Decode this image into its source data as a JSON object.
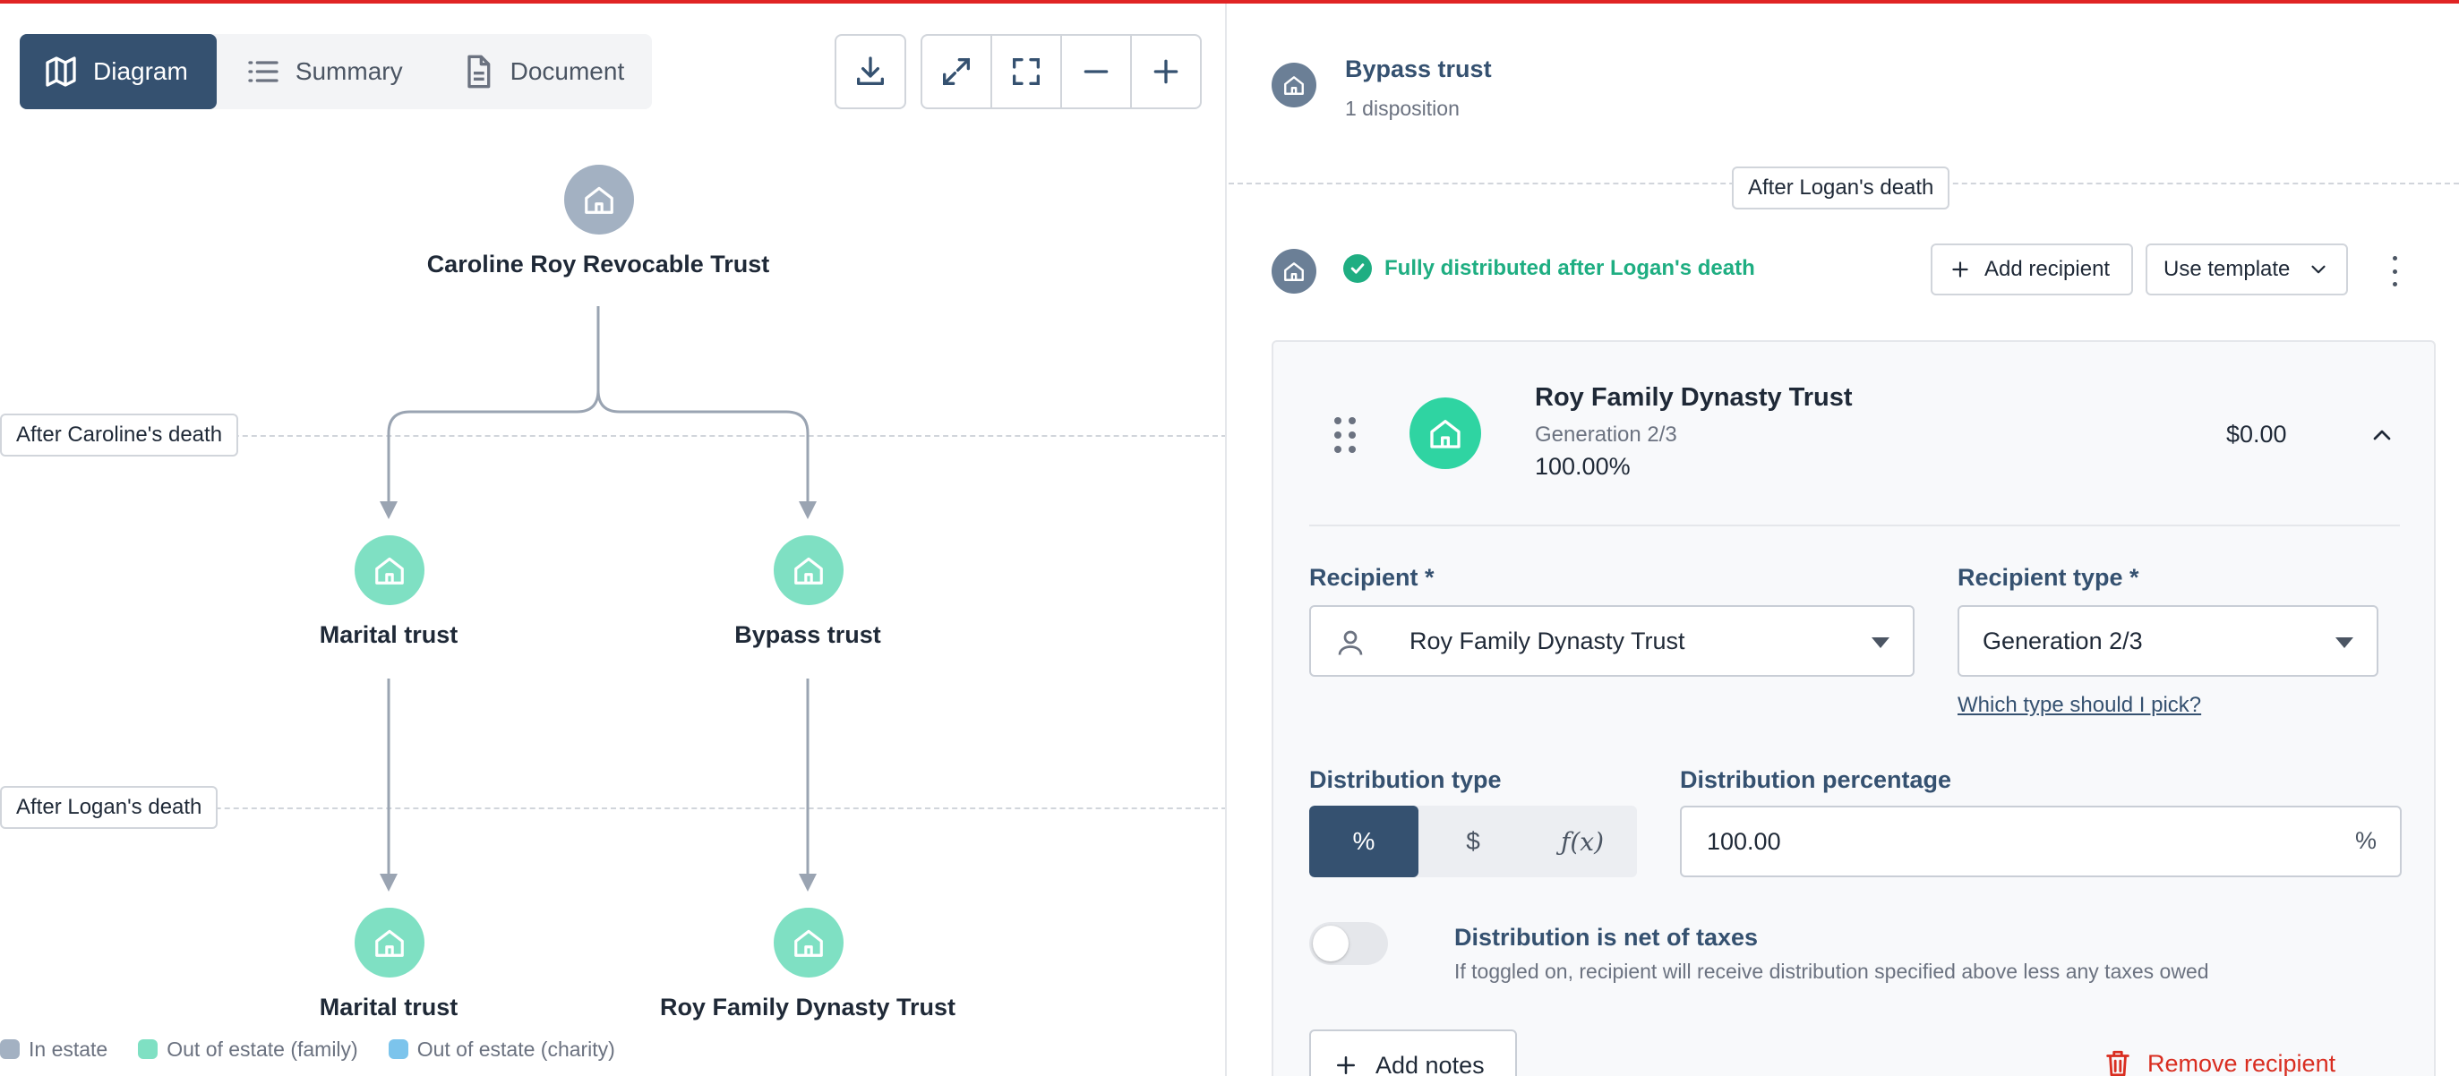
{
  "view_tabs": [
    {
      "label": "Diagram",
      "icon": "map-icon",
      "active": true
    },
    {
      "label": "Summary",
      "icon": "list-icon",
      "active": false
    },
    {
      "label": "Document",
      "icon": "document-icon",
      "active": false
    }
  ],
  "toolbar": {
    "download_icon": "download-icon",
    "expand_icon": "expand-icon",
    "fit_icon": "fit-screen-icon",
    "zoom_out_icon": "minus-icon",
    "zoom_in_icon": "plus-icon"
  },
  "diagram": {
    "root": {
      "label": "Caroline Roy Revocable Trust",
      "category": "In estate"
    },
    "phases": [
      "After Caroline's death",
      "After Logan's death"
    ],
    "level1": [
      {
        "label": "Marital trust",
        "category": "Out of estate (family)"
      },
      {
        "label": "Bypass trust",
        "category": "Out of estate (family)"
      }
    ],
    "level2": [
      {
        "label": "Marital trust",
        "category": "Out of estate (family)"
      },
      {
        "label": "Roy Family Dynasty Trust",
        "category": "Out of estate (family)"
      }
    ],
    "legend": [
      {
        "label": "In estate",
        "color": "#a3b1c2"
      },
      {
        "label": "Out of estate (family)",
        "color": "#7fe0c3"
      },
      {
        "label": "Out of estate (charity)",
        "color": "#7cc4ec"
      }
    ]
  },
  "panel": {
    "title": "Bypass trust",
    "subtitle": "1 disposition",
    "phase_tag": "After Logan's death",
    "status": "Fully distributed after Logan's death",
    "add_recipient_label": "Add recipient",
    "use_template_label": "Use template",
    "recipient_card": {
      "name": "Roy Family Dynasty Trust",
      "generation": "Generation 2/3",
      "percent": "100.00%",
      "amount": "$0.00",
      "recipient_label": "Recipient *",
      "recipient_value": "Roy Family Dynasty Trust",
      "recipient_type_label": "Recipient type *",
      "recipient_type_value": "Generation 2/3",
      "type_help_link": "Which type should I pick?",
      "distribution_type_label": "Distribution type",
      "distribution_type_options": [
        "%",
        "$",
        "ƒ(x)"
      ],
      "distribution_type_selected": "%",
      "distribution_percentage_label": "Distribution percentage",
      "distribution_percentage_value": "100.00",
      "distribution_percentage_suffix": "%",
      "net_of_taxes_label": "Distribution is net of taxes",
      "net_of_taxes_help": "If toggled on, recipient will receive distribution specified above less any taxes owed",
      "net_of_taxes_on": false,
      "add_notes_label": "Add notes",
      "remove_label": "Remove recipient"
    }
  },
  "colors": {
    "accent": "#355170",
    "success": "#1fae82",
    "danger": "#d92d20",
    "family_node": "#7fe0c3",
    "estate_node": "#a3b1c2"
  }
}
